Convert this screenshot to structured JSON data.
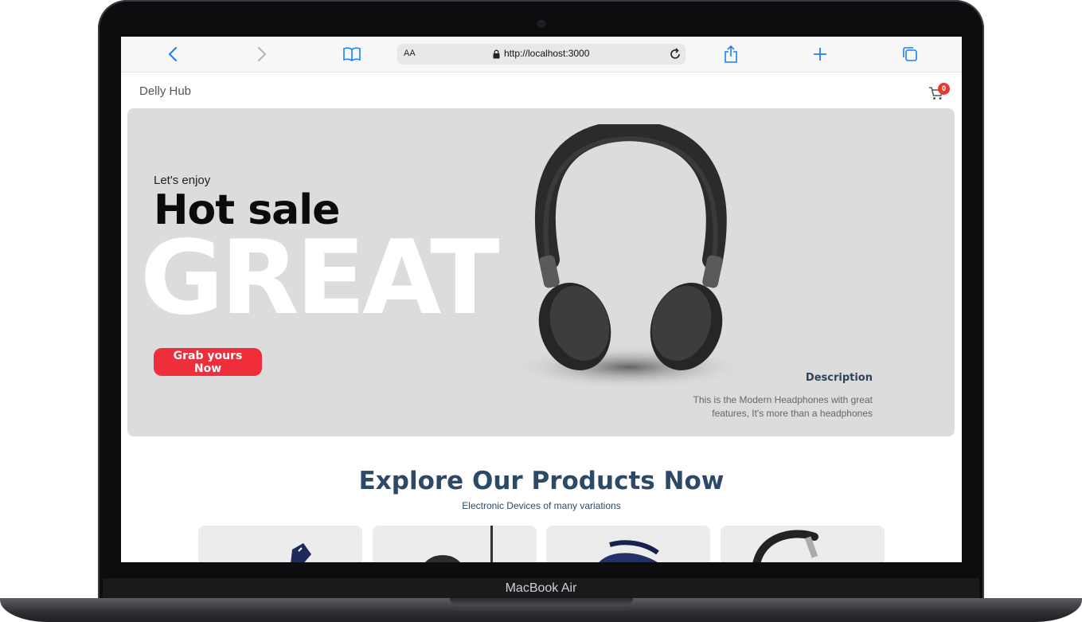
{
  "device": {
    "model_label": "MacBook Air"
  },
  "browser": {
    "text_size_label": "AA",
    "url": "http://localhost:3000"
  },
  "header": {
    "brand": "Delly Hub",
    "cart_count": "0"
  },
  "hero": {
    "subtitle": "Let's enjoy",
    "title": "Hot sale",
    "big_word": "GREAT",
    "cta_label": "Grab yours Now",
    "description_title": "Description",
    "description_text": "This is the Modern Headphones with great features, It's more than a headphones"
  },
  "products_section": {
    "title": "Explore Our Products Now",
    "subtitle": "Electronic Devices of many variations"
  },
  "colors": {
    "accent": "#ef2d3b",
    "heading": "#2c4a67",
    "hero_bg": "#dcdcdc",
    "browser_icon": "#1b7ff5"
  }
}
